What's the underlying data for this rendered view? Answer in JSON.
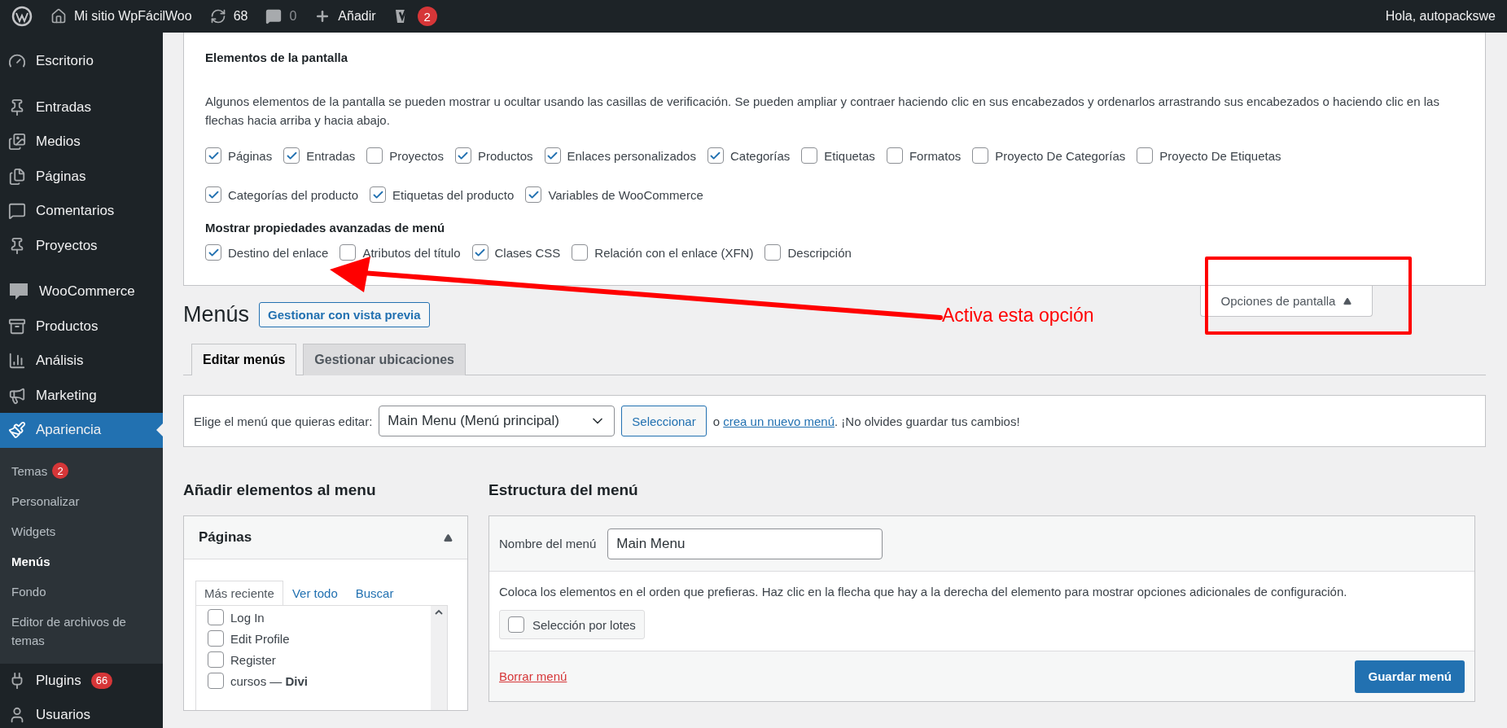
{
  "admin_bar": {
    "site": "Mi sitio WpFácilWoo",
    "updates": "68",
    "comments": "0",
    "new": "Añadir",
    "seo_badge": "2",
    "greeting": "Hola, autopackswe"
  },
  "sidebar": {
    "groups": [
      [
        {
          "label": "Escritorio",
          "selected": false
        }
      ],
      [
        {
          "label": "Entradas",
          "selected": false
        },
        {
          "label": "Medios",
          "selected": false
        },
        {
          "label": "Páginas",
          "selected": false
        },
        {
          "label": "Comentarios",
          "selected": false
        },
        {
          "label": "Proyectos",
          "selected": false
        }
      ],
      [
        {
          "label": "WooCommerce",
          "selected": false
        },
        {
          "label": "Productos",
          "selected": false
        },
        {
          "label": "Análisis",
          "selected": false
        },
        {
          "label": "Marketing",
          "selected": false
        },
        {
          "label": "Apariencia",
          "selected": true,
          "children": [
            {
              "label": "Temas",
              "badge": "2",
              "selected": false
            },
            {
              "label": "Personalizar",
              "selected": false
            },
            {
              "label": "Widgets",
              "selected": false
            },
            {
              "label": "Menús",
              "selected": true
            },
            {
              "label": "Fondo",
              "selected": false
            },
            {
              "label": "Editor de archivos de temas",
              "selected": false
            }
          ]
        },
        {
          "label": "Plugins",
          "badge": "66",
          "selected": false
        },
        {
          "label": "Usuarios",
          "selected": false
        }
      ]
    ]
  },
  "screen_options": {
    "heading": "Elementos de la pantalla",
    "description": "Algunos elementos de la pantalla se pueden mostrar u ocultar usando las casillas de verificación. Se pueden ampliar y contraer haciendo clic en sus encabezados y ordenarlos arrastrando sus encabezados o haciendo clic en las flechas hacia arriba y hacia abajo.",
    "boxes": [
      {
        "label": "Páginas",
        "checked": true
      },
      {
        "label": "Entradas",
        "checked": true
      },
      {
        "label": "Proyectos",
        "checked": false
      },
      {
        "label": "Productos",
        "checked": true
      },
      {
        "label": "Enlaces personalizados",
        "checked": true
      },
      {
        "label": "Categorías",
        "checked": true
      },
      {
        "label": "Etiquetas",
        "checked": false
      },
      {
        "label": "Formatos",
        "checked": false
      },
      {
        "label": "Proyecto De Categorías",
        "checked": false
      },
      {
        "label": "Proyecto De Etiquetas",
        "checked": false
      },
      {
        "label": "Categorías del producto",
        "checked": true
      },
      {
        "label": "Etiquetas del producto",
        "checked": true
      },
      {
        "label": "Variables de WooCommerce",
        "checked": true
      }
    ],
    "advanced_heading": "Mostrar propiedades avanzadas de menú",
    "advanced": [
      {
        "label": "Destino del enlace",
        "checked": true
      },
      {
        "label": "Atributos del título",
        "checked": false
      },
      {
        "label": "Clases CSS",
        "checked": true
      },
      {
        "label": "Relación con el enlace (XFN)",
        "checked": false
      },
      {
        "label": "Descripción",
        "checked": false
      }
    ],
    "toggle": {
      "label": "Opciones de pantalla",
      "expanded": true
    }
  },
  "page": {
    "title": "Menús",
    "preview_button": "Gestionar con vista previa",
    "tabs": [
      {
        "label": "Editar menús",
        "selected": true
      },
      {
        "label": "Gestionar ubicaciones",
        "selected": false
      }
    ],
    "select_bar": {
      "label": "Elige el menú que quieras editar:",
      "value": "Main Menu (Menú principal)",
      "button": "Seleccionar",
      "before": "o",
      "link": "crea un nuevo menú",
      "after": ". ¡No olvides guardar tus cambios!"
    }
  },
  "add_items": {
    "heading": "Añadir elementos al menu",
    "box": {
      "title": "Páginas",
      "expanded": true,
      "tabs": [
        {
          "label": "Más reciente",
          "selected": true
        },
        {
          "label": "Ver todo",
          "selected": false
        },
        {
          "label": "Buscar",
          "selected": false
        }
      ],
      "items": [
        {
          "label": "Log In",
          "checked": false
        },
        {
          "label": "Edit Profile",
          "checked": false
        },
        {
          "label": "Register",
          "checked": false
        },
        {
          "label": "cursos — **Divi**",
          "checked": false
        }
      ]
    }
  },
  "structure": {
    "heading": "Estructura del menú",
    "name_label": "Nombre del menú",
    "name_value": "Main Menu",
    "instructions": "Coloca los elementos en el orden que prefieras. Haz clic en la flecha que hay a la derecha del elemento para mostrar opciones adicionales de configuración.",
    "bulk_select": {
      "label": "Selección por lotes",
      "checked": false
    },
    "delete_link": "Borrar menú",
    "save_button": "Guardar menú"
  },
  "annotation": {
    "text": "Activa esta opción"
  }
}
